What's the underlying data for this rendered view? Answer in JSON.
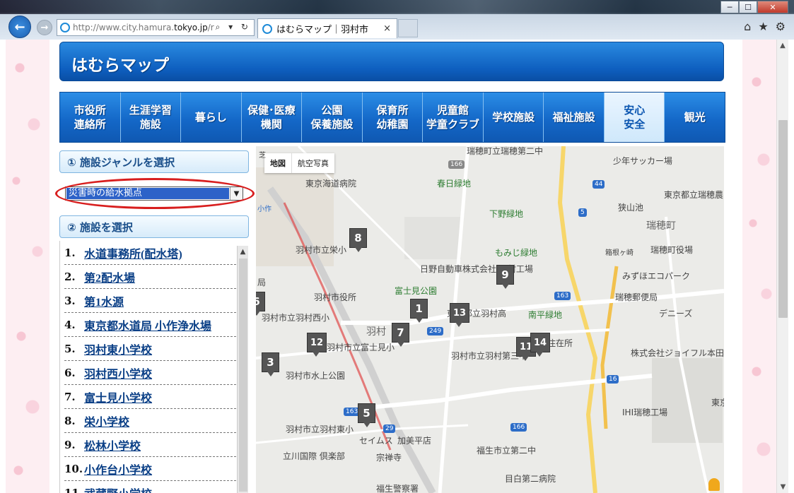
{
  "browser": {
    "url_dim": "http://www.city.hamura.",
    "url_bold": "tokyo.jp",
    "url_rest": "/r",
    "addr_tools": "⌕ ▾ ↻",
    "tab_title": "はむらマップ｜羽村市",
    "tab_close": "×",
    "win_min": "─",
    "win_max": "☐",
    "win_close": "✕",
    "back": "←",
    "forward": "→",
    "home": "⌂",
    "star": "★",
    "gear": "⚙"
  },
  "site": {
    "title": "はむらマップ"
  },
  "categories": [
    {
      "line1": "市役所",
      "line2": "連絡所"
    },
    {
      "line1": "生涯学習",
      "line2": "施設"
    },
    {
      "line1": "暮らし",
      "line2": ""
    },
    {
      "line1": "保健･医療",
      "line2": "機関"
    },
    {
      "line1": "公園",
      "line2": "保養施設"
    },
    {
      "line1": "保育所",
      "line2": "幼稚園"
    },
    {
      "line1": "児童館",
      "line2": "学童クラブ"
    },
    {
      "line1": "学校施設",
      "line2": ""
    },
    {
      "line1": "福祉施設",
      "line2": ""
    },
    {
      "line1": "安心",
      "line2": "安全"
    },
    {
      "line1": "観光",
      "line2": ""
    }
  ],
  "panel": {
    "section1": "① 施設ジャンルを選択",
    "genre_selected": "災害時の給水拠点",
    "section2": "② 施設を選択"
  },
  "facilities": [
    {
      "num": "1.",
      "name": "水道事務所(配水塔)"
    },
    {
      "num": "2.",
      "name": "第2配水場"
    },
    {
      "num": "3.",
      "name": "第1水源"
    },
    {
      "num": "4.",
      "name": "東京都水道局 小作浄水場"
    },
    {
      "num": "5.",
      "name": "羽村東小学校"
    },
    {
      "num": "6.",
      "name": "羽村西小学校"
    },
    {
      "num": "7.",
      "name": "富士見小学校"
    },
    {
      "num": "8.",
      "name": "栄小学校"
    },
    {
      "num": "9.",
      "name": "松林小学校"
    },
    {
      "num": "10.",
      "name": "小作台小学校"
    },
    {
      "num": "11.",
      "name": "武蔵野小学校"
    }
  ],
  "map": {
    "type_map": "地図",
    "type_satellite": "航空写真",
    "labels": [
      "瑞穂町立瑞穂第二中",
      "少年サッカー場",
      "東京海道病院",
      "春日緑地",
      "東京都立瑞穂農",
      "狭山池",
      "下野緑地",
      "瑞穂町",
      "羽村市立栄小",
      "もみじ緑地",
      "箱根ヶ崎",
      "瑞穂町役場",
      "日野自動車株式会社 羽村工場",
      "みずほエコパーク",
      "富士見公園",
      "羽村市役所",
      "瑞穂郵便局",
      "羽村市立羽村西小",
      "東京都立羽村高",
      "南平緑地",
      "デニーズ",
      "羽村",
      "羽村市立富士見小",
      "羽村市立羽村第三中",
      "住在所",
      "株式会社ジョイフル本田 瑞穂店",
      "羽村市水上公園",
      "IHI瑞穂工場",
      "羽村市立羽村東小",
      "加美平店",
      "セイムス",
      "宗禅寺",
      "福生市立第二中",
      "立川国際 倶楽部",
      "福生警察署",
      "目白第二病院",
      "芝",
      "局",
      "小作",
      "東京"
    ],
    "markers": [
      "8",
      "9",
      "1",
      "13",
      "7",
      "11",
      "14",
      "12",
      "3",
      "5",
      "6"
    ],
    "road_badges": [
      "44",
      "5",
      "163",
      "249",
      "166",
      "29",
      "163",
      "16",
      "166"
    ]
  }
}
